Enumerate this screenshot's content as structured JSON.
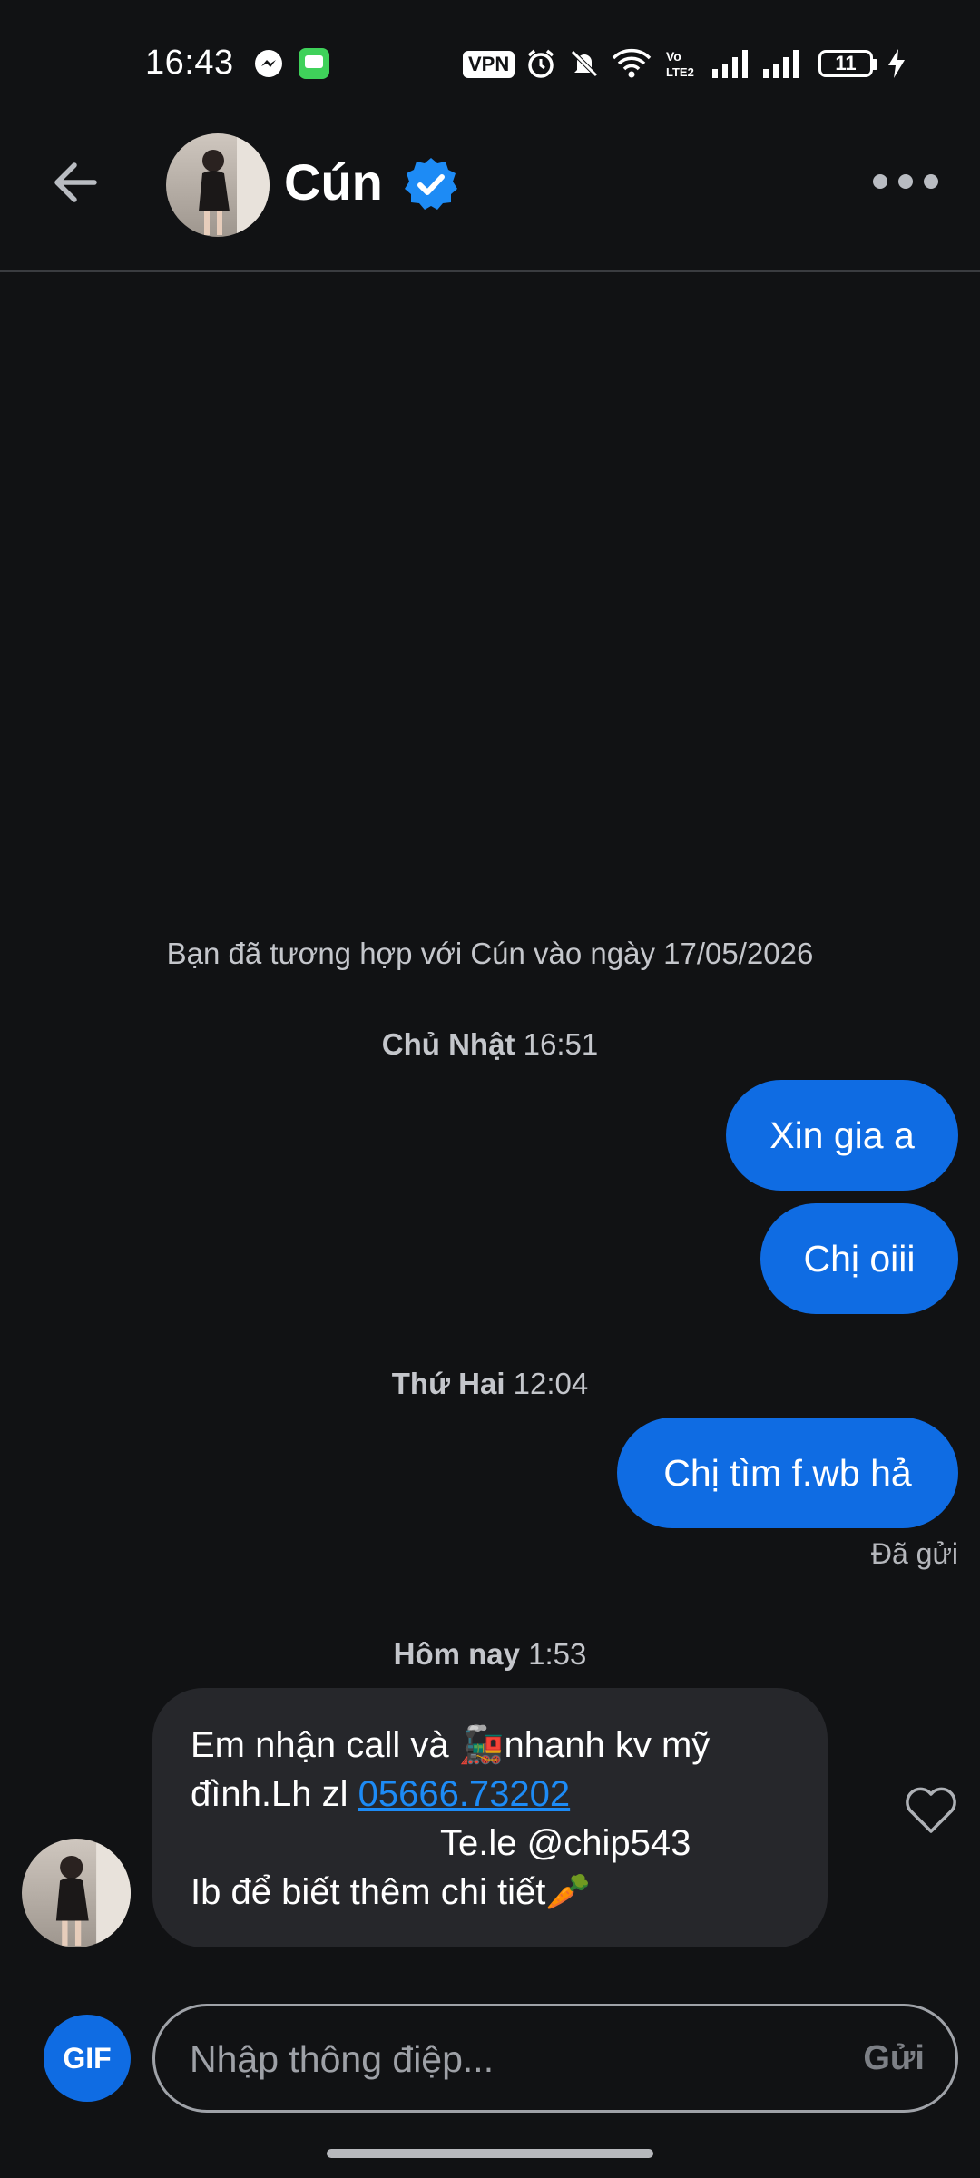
{
  "status_bar": {
    "time": "16:43",
    "vpn_label": "VPN",
    "battery_level": "11",
    "icons": [
      "messenger-icon",
      "messages-icon",
      "vpn-icon",
      "alarm-icon",
      "mute-icon",
      "wifi-icon",
      "volte-icon",
      "signal-icon",
      "signal-icon",
      "battery-icon",
      "charging-icon"
    ]
  },
  "header": {
    "contact_name": "Cún",
    "verified": true,
    "icons": [
      "back-arrow-icon",
      "verified-badge-icon",
      "more-icon"
    ]
  },
  "chat": {
    "match_info": "Bạn đã tương hợp với Cún vào ngày 17/05/2026",
    "groups": [
      {
        "day": "Chủ Nhật",
        "time": "16:51",
        "messages": [
          "Xin gia a",
          "Chị oiii"
        ]
      },
      {
        "day": "Thứ Hai",
        "time": "12:04",
        "messages": [
          "Chị tìm f.wb hả"
        ],
        "status": "Đã gửi"
      },
      {
        "day": "Hôm nay",
        "time": "1:53"
      }
    ],
    "incoming": {
      "line1": "Em nhận call  và 🚂nhanh kv mỹ",
      "line2_prefix": "đình.Lh zl ",
      "line2_link": "05666.73202",
      "line3": "Te.le @chip543",
      "line4": "Ib để biết thêm chi tiết🥕"
    }
  },
  "composer": {
    "gif_label": "GIF",
    "placeholder": "Nhập thông điệp...",
    "send_label": "Gửi"
  },
  "colors": {
    "background": "#111214",
    "accent": "#0f6ce3",
    "incoming_bubble": "#26272b",
    "link": "#1d8bf5"
  }
}
